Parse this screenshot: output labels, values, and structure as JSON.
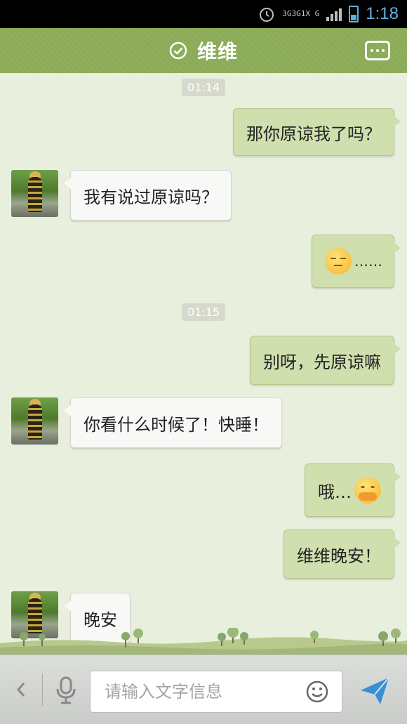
{
  "status_bar": {
    "network": [
      "3G",
      "3G",
      "1X",
      "G"
    ],
    "time": "1:18"
  },
  "header": {
    "title": "维维"
  },
  "messages": [
    {
      "type": "timestamp",
      "text": "01:14"
    },
    {
      "type": "out",
      "text": "那你原谅我了吗？"
    },
    {
      "type": "in",
      "text": "我有说过原谅吗？"
    },
    {
      "type": "out",
      "text": "……",
      "emoji": "sleepy-emoji"
    },
    {
      "type": "timestamp",
      "text": "01:15"
    },
    {
      "type": "out",
      "text": "别呀，先原谅嘛"
    },
    {
      "type": "in",
      "text": "你看什么时候了！快睡！"
    },
    {
      "type": "out",
      "text": "哦…",
      "emoji": "shy-cover-mouth-emoji"
    },
    {
      "type": "out",
      "text": "维维晚安！"
    },
    {
      "type": "in",
      "text": "晚安"
    }
  ],
  "input": {
    "placeholder": "请输入文字信息",
    "value": ""
  },
  "colors": {
    "header": "#8bab57",
    "chat_bg": "#e8efdc",
    "outgoing_bubble": "#cfdfae",
    "incoming_bubble": "#f8f8f6",
    "send_icon": "#3b8fd1"
  }
}
